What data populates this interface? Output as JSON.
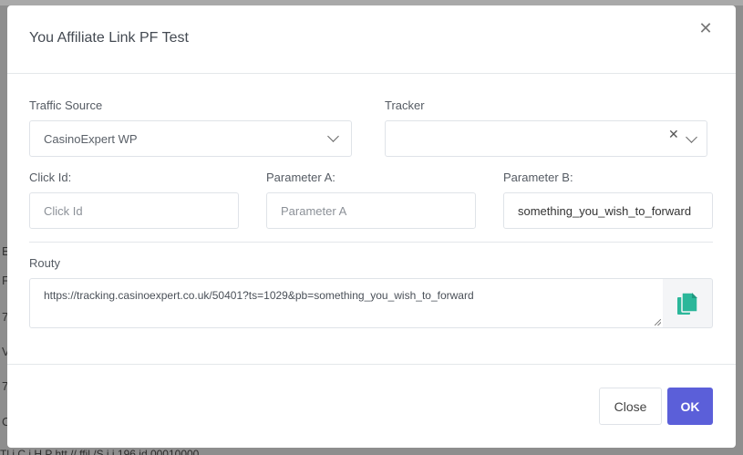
{
  "background": {
    "row_chars": [
      "E",
      "F",
      "7",
      "V",
      "7",
      "C"
    ],
    "bottom_text": "Tl i  C i  H  P    htt //    ffil  /S   i  i  196      id 00010000"
  },
  "modal": {
    "title": "You Affiliate Link PF Test",
    "traffic_source": {
      "label": "Traffic Source",
      "value": "CasinoExpert WP"
    },
    "tracker": {
      "label": "Tracker",
      "value": ""
    },
    "click_id": {
      "label": "Click Id:",
      "placeholder": "Click Id",
      "value": ""
    },
    "parameter_a": {
      "label": "Parameter A:",
      "placeholder": "Parameter A",
      "value": ""
    },
    "parameter_b": {
      "label": "Parameter B:",
      "placeholder": "",
      "value": "something_you_wish_to_forward"
    },
    "routy": {
      "label": "Routy",
      "url": "https://tracking.casinoexpert.co.uk/50401?ts=1029&pb=something_you_wish_to_forward"
    },
    "buttons": {
      "close_label": "Close",
      "ok_label": "OK"
    }
  },
  "colors": {
    "accent": "#5b5fd9",
    "copy_icon": "#2bb79a"
  },
  "icons": {
    "close": "close-icon",
    "chevron": "chevron-down-icon",
    "clear": "clear-icon",
    "copy": "copy-icon"
  }
}
